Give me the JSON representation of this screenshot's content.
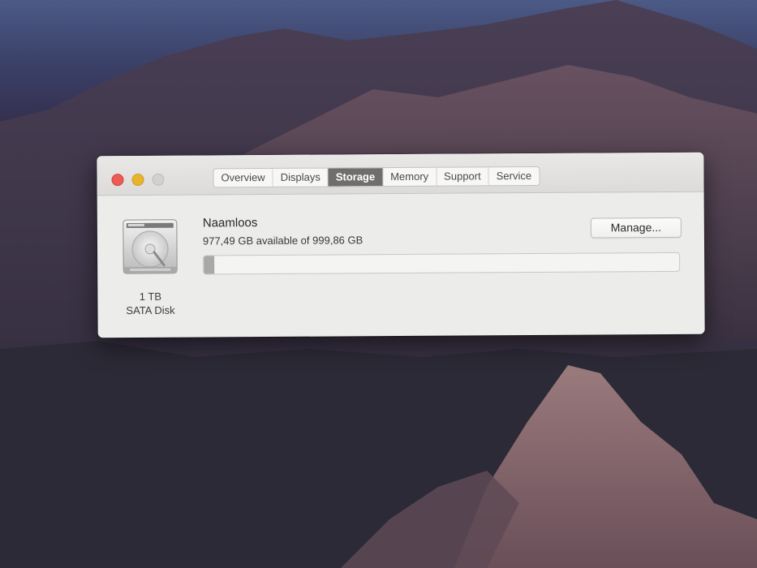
{
  "window": {
    "tabs": [
      {
        "label": "Overview",
        "active": false
      },
      {
        "label": "Displays",
        "active": false
      },
      {
        "label": "Storage",
        "active": true
      },
      {
        "label": "Memory",
        "active": false
      },
      {
        "label": "Support",
        "active": false
      },
      {
        "label": "Service",
        "active": false
      }
    ]
  },
  "disk": {
    "icon": "hard-drive-icon",
    "capacity": "1 TB",
    "type": "SATA Disk",
    "name": "Naamloos",
    "available_text": "977,49 GB available of 999,86 GB",
    "used_fraction": 0.022,
    "manage_label": "Manage..."
  },
  "colors": {
    "close": "#ec5b55",
    "minimize": "#e7b52c",
    "maximize": "#d2d1cf",
    "active_tab": "#6f6e6c"
  }
}
